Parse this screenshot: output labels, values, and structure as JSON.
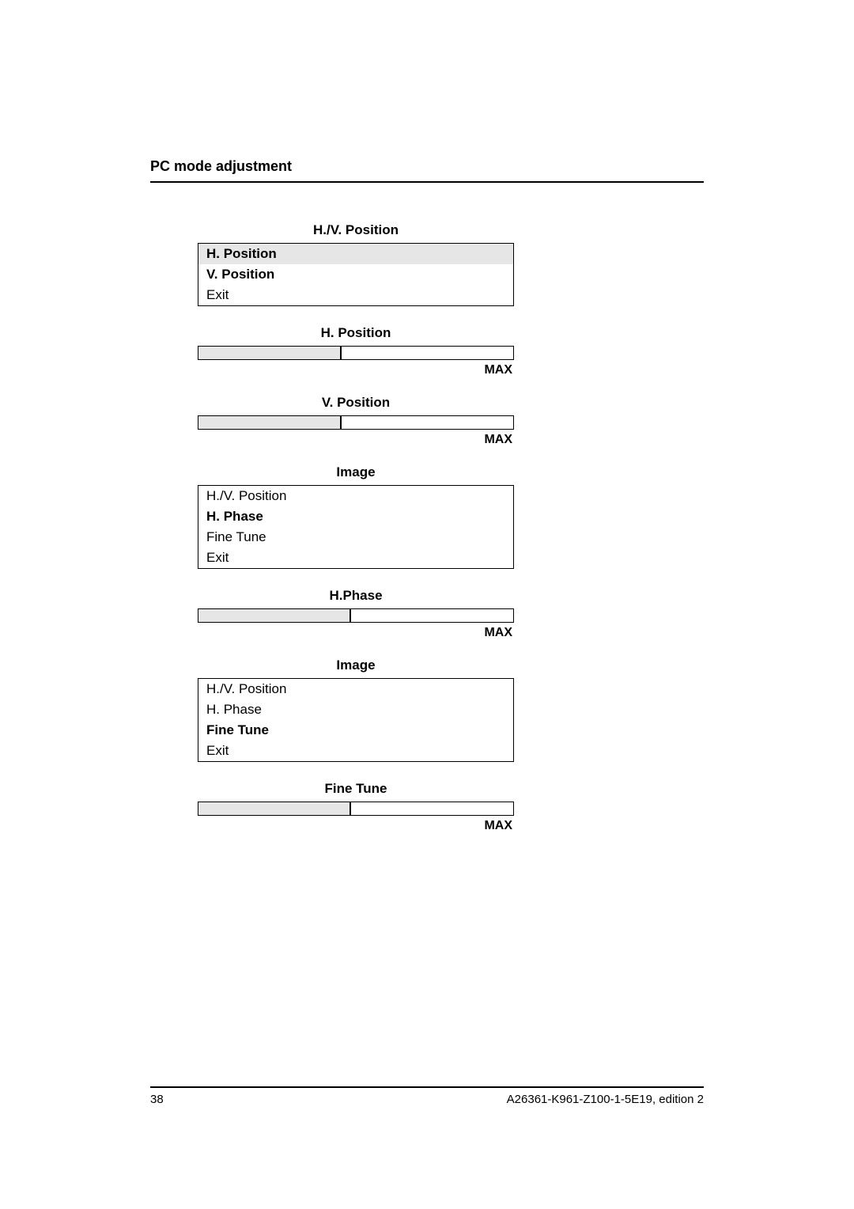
{
  "header": {
    "title": "PC mode adjustment"
  },
  "sections": {
    "hvpos": {
      "title": "H./V. Position",
      "items": [
        "H. Position",
        "V. Position",
        "Exit"
      ]
    },
    "hpos": {
      "title": "H. Position",
      "max": "MAX"
    },
    "vpos": {
      "title": "V. Position",
      "max": "MAX"
    },
    "image1": {
      "title": "Image",
      "items": [
        "H./V. Position",
        "H. Phase",
        "Fine Tune",
        "Exit"
      ]
    },
    "hphase": {
      "title": "H.Phase",
      "max": "MAX"
    },
    "image2": {
      "title": "Image",
      "items": [
        "H./V. Position",
        "H. Phase",
        "Fine Tune",
        "Exit"
      ]
    },
    "finetune": {
      "title": "Fine Tune",
      "max": "MAX"
    }
  },
  "footer": {
    "page": "38",
    "doc": "A26361-K961-Z100-1-5E19, edition 2"
  }
}
